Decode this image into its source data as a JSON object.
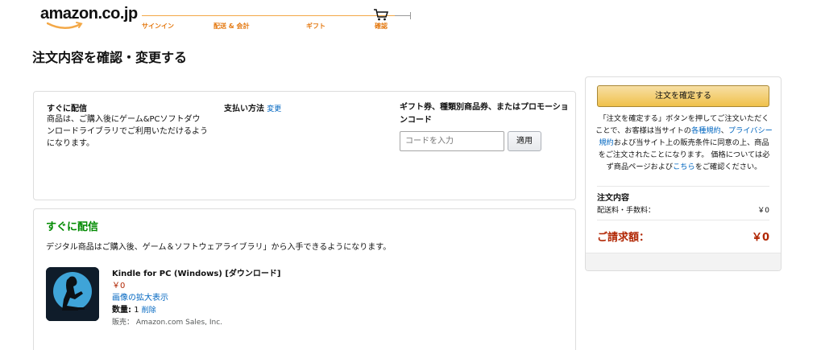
{
  "header": {
    "logo_text": "amazon.co.jp",
    "steps": [
      "サインイン",
      "配送 & 会計",
      "ギフト",
      "確認"
    ]
  },
  "page": {
    "title": "注文内容を確認・変更する"
  },
  "top_panel": {
    "delivery_heading": "すぐに配信",
    "delivery_text": "商品は、ご購入後にゲーム&PCソフトダウンロードライブラリでご利用いただけるようになります。",
    "payment_heading": "支払い方法",
    "payment_change": "変更",
    "gift_heading": "ギフト券、種類別商品券、またはプロモーションコード",
    "code_placeholder": "コードを入力",
    "apply_label": "適用"
  },
  "delivery": {
    "title": "すぐに配信",
    "description": "デジタル商品はご購入後、ゲーム＆ソフトウェアライブラリ」から入手できるようになります。",
    "item": {
      "title": "Kindle for PC (Windows) [ダウンロード]",
      "price": "￥0",
      "zoom_link": "画像の拡大表示",
      "qty_label": "数量:",
      "qty_value": "1",
      "delete_link": "削除",
      "seller": "販売： Amazon.com Sales, Inc."
    }
  },
  "summary": {
    "place_order": "注文を確定する",
    "note_1": "「注文を確定する」ボタンを押してご注文いただくことで、お客様は当サイトの",
    "note_link_terms": "各種規約",
    "note_2": "、",
    "note_link_privacy": "プライバシー規約",
    "note_3": "および当サイト上の販売条件に同意の上、商品をご注文されたことになります。 価格については必ず商品ページおよび",
    "note_link_here": "こちら",
    "note_4": "をご確認ください。",
    "order_heading": "注文内容",
    "shipping_label": "配送料・手数料：",
    "shipping_value": "￥0",
    "total_label": "ご請求額：",
    "total_value": "￥0"
  },
  "colors": {
    "accent_orange": "#e47911",
    "link_blue": "#0066c0",
    "price_red": "#b12704",
    "delivery_green": "#008a00",
    "button_yellow": "#f0c14b"
  },
  "icons": [
    "amazon-smile-logo",
    "cart-icon",
    "kindle-reader-icon"
  ]
}
